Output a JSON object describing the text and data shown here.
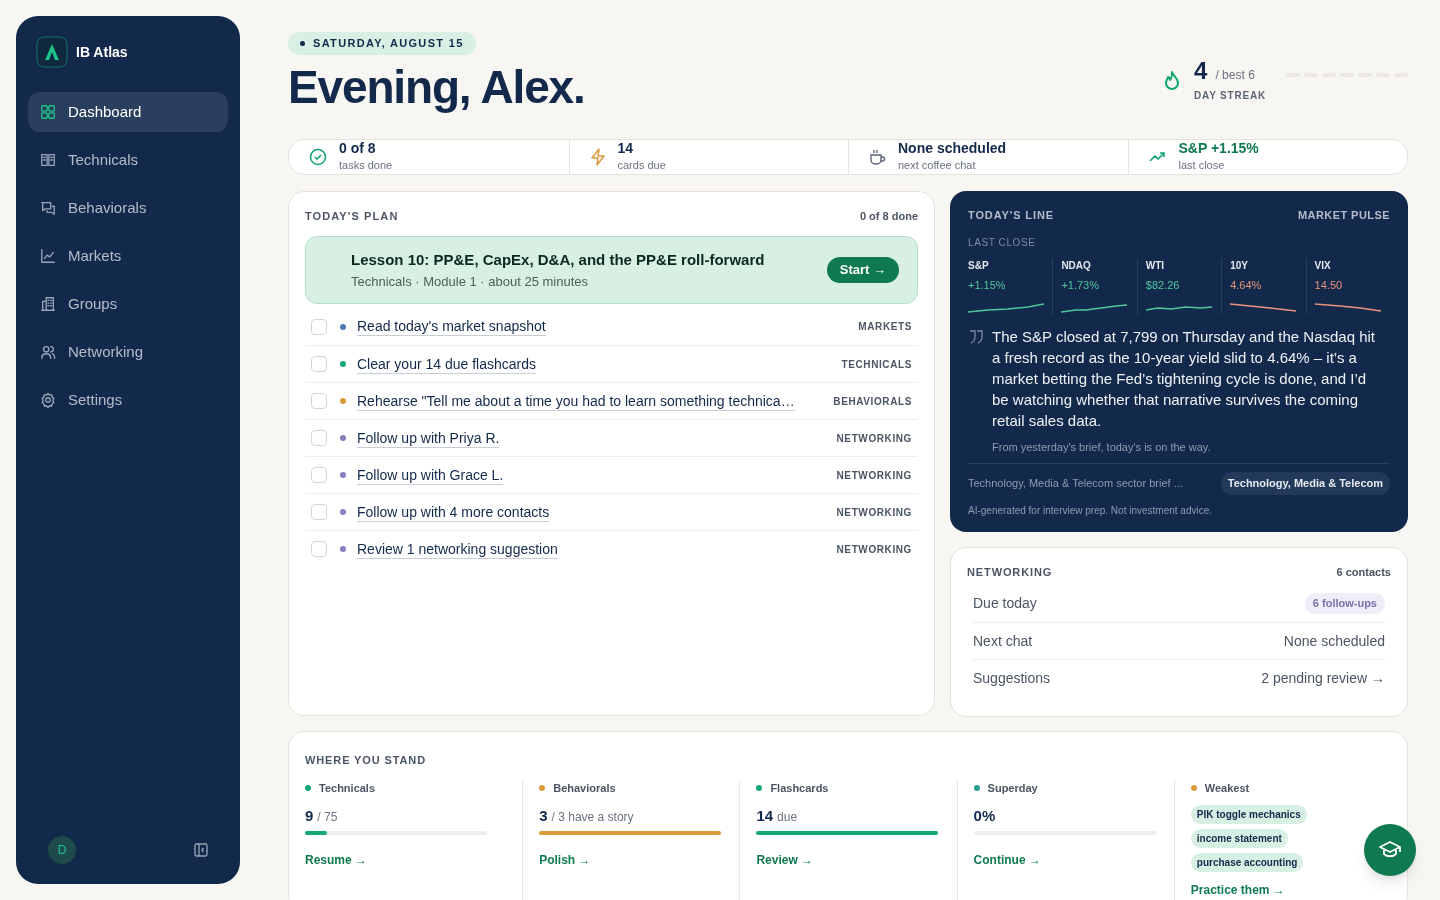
{
  "sidebar": {
    "brand": "IB Atlas",
    "items": [
      {
        "label": "Dashboard",
        "selected": true
      },
      {
        "label": "Technicals",
        "selected": false
      },
      {
        "label": "Behaviorals",
        "selected": false
      },
      {
        "label": "Markets",
        "selected": false
      },
      {
        "label": "Groups",
        "selected": false
      },
      {
        "label": "Networking",
        "selected": false
      },
      {
        "label": "Settings",
        "selected": false
      }
    ],
    "avatar": "D"
  },
  "header": {
    "date": "SATURDAY, AUGUST 15",
    "greeting": "Evening, Alex.",
    "streak": {
      "count": "4",
      "best": "/ best 6",
      "label": "DAY STREAK"
    }
  },
  "stats": [
    {
      "value": "0 of 8",
      "caption": "tasks done",
      "kind": "plain"
    },
    {
      "value": "14",
      "caption": "cards due",
      "kind": "plain"
    },
    {
      "value": "None scheduled",
      "caption": "next coffee chat",
      "kind": "plain"
    },
    {
      "value": "S&P +1.15%",
      "caption": "last close",
      "kind": "positive"
    }
  ],
  "plan": {
    "title": "TODAY'S PLAN",
    "progress": "0 of 8 done",
    "lesson": {
      "title": "Lesson 10: PP&E, CapEx, D&A, and the PP&E roll-forward",
      "meta": "Technicals · Module 1 · about 25 minutes",
      "button": "Start →"
    },
    "tasks": [
      {
        "text": "Read today's market snapshot",
        "category": "MARKETS",
        "color": "#4a7ab5",
        "checked": false
      },
      {
        "text": "Clear your 14 due flashcards",
        "category": "TECHNICALS",
        "color": "#14a874",
        "checked": false
      },
      {
        "text": "Rehearse \"Tell me about a time you had to learn something technica…",
        "category": "BEHAVIORALS",
        "color": "#d99a3a",
        "checked": false
      },
      {
        "text": "Follow up with Priya R.",
        "category": "NETWORKING",
        "color": "#8c7bbd",
        "checked": false
      },
      {
        "text": "Follow up with Grace L.",
        "category": "NETWORKING",
        "color": "#8c7bbd",
        "checked": false
      },
      {
        "text": "Follow up with 4 more contacts",
        "category": "NETWORKING",
        "color": "#8c7bbd",
        "checked": false
      },
      {
        "text": "Review 1 networking suggestion",
        "category": "NETWORKING",
        "color": "#8c7bbd",
        "checked": false
      }
    ]
  },
  "market": {
    "title": "TODAY'S LINE",
    "link": "MARKET PULSE",
    "subtitle": "LAST CLOSE",
    "tickers": [
      {
        "symbol": "S&P",
        "value": "+1.15%",
        "color": "#4fc79a"
      },
      {
        "symbol": "NDAQ",
        "value": "+1.73%",
        "color": "#4fc79a"
      },
      {
        "symbol": "WTI",
        "value": "$82.26",
        "color": "#4fc79a"
      },
      {
        "symbol": "10Y",
        "value": "4.64%",
        "color": "#e8937a"
      },
      {
        "symbol": "VIX",
        "value": "14.50",
        "color": "#e8937a"
      }
    ],
    "quote": "The S&P closed at 7,799 on Thursday and the Nasdaq hit a fresh record as the 10-year yield slid to 4.64% – it’s a market betting the Fed’s tightening cycle is done, and I’d be watching whether that narrative survives the coming retail sales data.",
    "source": "From yesterday's brief, today's is on the way.",
    "brief": "Technology, Media & Telecom sector brief ...",
    "sector": "Technology, Media & Telecom",
    "disclaimer": "AI-generated for interview prep. Not investment advice."
  },
  "networking": {
    "title": "NETWORKING",
    "count": "6 contacts",
    "rows": [
      {
        "label": "Due today",
        "value": "6 follow-ups",
        "kind": "pill"
      },
      {
        "label": "Next chat",
        "value": "None scheduled",
        "kind": "text"
      },
      {
        "label": "Suggestions",
        "value": "2 pending review →",
        "kind": "link"
      }
    ]
  },
  "standing": {
    "title": "WHERE YOU STAND",
    "sections": [
      {
        "name": "Technicals",
        "color": "#14a874",
        "value": "9",
        "suffix": "/ 75",
        "level": 0.12,
        "link": "Resume →"
      },
      {
        "name": "Behaviorals",
        "color": "#d99a3a",
        "value": "3",
        "suffix": "/ 3 have a story",
        "level": 1,
        "link": "Polish →"
      },
      {
        "name": "Flashcards",
        "color": "#14a874",
        "value": "14",
        "suffix": "due",
        "level": 1,
        "link": "Review →"
      },
      {
        "name": "Superday",
        "color": "#2a9d8f",
        "value": "0%",
        "level": 0,
        "link": "Continue →"
      }
    ],
    "weakest": {
      "name": "Weakest",
      "color": "#d99a3a",
      "tags": [
        "PIK toggle mechanics",
        "income statement",
        "purchase accounting"
      ],
      "link": "Practice them →"
    }
  }
}
